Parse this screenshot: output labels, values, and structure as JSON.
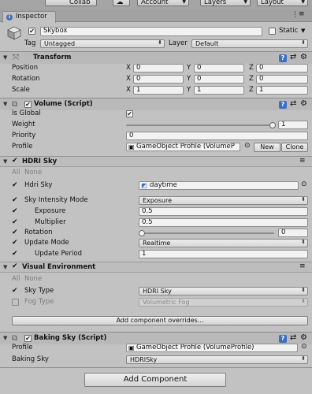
{
  "toolbar": {
    "collab": "Collab",
    "account": "Account",
    "layers": "Layers",
    "layout": "Layout"
  },
  "tab": {
    "title": "Inspector"
  },
  "gameobject": {
    "name": "Skybox",
    "static_label": "Static",
    "tag_label": "Tag",
    "tag_value": "Untagged",
    "layer_label": "Layer",
    "layer_value": "Default"
  },
  "transform": {
    "title": "Transform",
    "rows": [
      {
        "label": "Position",
        "x": "0",
        "y": "0",
        "z": "0"
      },
      {
        "label": "Rotation",
        "x": "0",
        "y": "0",
        "z": "0"
      },
      {
        "label": "Scale",
        "x": "1",
        "y": "1",
        "z": "1"
      }
    ],
    "axis": {
      "x": "X",
      "y": "Y",
      "z": "Z"
    }
  },
  "volume": {
    "title": "Volume (Script)",
    "is_global_label": "Is Global",
    "weight_label": "Weight",
    "weight_value": "1",
    "weight_fraction": 1.0,
    "priority_label": "Priority",
    "priority_value": "0",
    "profile_label": "Profile",
    "profile_value": "GameObject Profile (VolumeP",
    "new_button": "New",
    "clone_button": "Clone"
  },
  "hdri_sky": {
    "title": "HDRI Sky",
    "all_label": "All",
    "none_label": "None",
    "hdri_label": "Hdri Sky",
    "hdri_value": "daytime",
    "intensity_mode_label": "Sky Intensity Mode",
    "intensity_mode_value": "Exposure",
    "exposure_label": "Exposure",
    "exposure_value": "0.5",
    "multiplier_label": "Multiplier",
    "multiplier_value": "0.5",
    "rotation_label": "Rotation",
    "rotation_value": "0",
    "rotation_fraction": 0.0,
    "update_mode_label": "Update Mode",
    "update_mode_value": "Realtime",
    "update_period_label": "Update Period",
    "update_period_value": "1"
  },
  "visual_env": {
    "title": "Visual Environment",
    "all_label": "All",
    "none_label": "None",
    "sky_type_label": "Sky Type",
    "sky_type_value": "HDRI Sky",
    "fog_type_label": "Fog Type",
    "fog_type_value": "Volumetric Fog"
  },
  "add_overrides_button": "Add component overrides...",
  "baking_sky": {
    "title": "Baking Sky (Script)",
    "profile_label": "Profile",
    "profile_value": "GameObject Profile (VolumeProfile)",
    "baking_label": "Baking Sky",
    "baking_value": "HDRISky"
  },
  "add_component_button": "Add Component",
  "colors": {
    "accent_blue": "#3c6fc4",
    "header_bg": "#b9b9b9",
    "panel_bg": "#c2c2c2"
  }
}
